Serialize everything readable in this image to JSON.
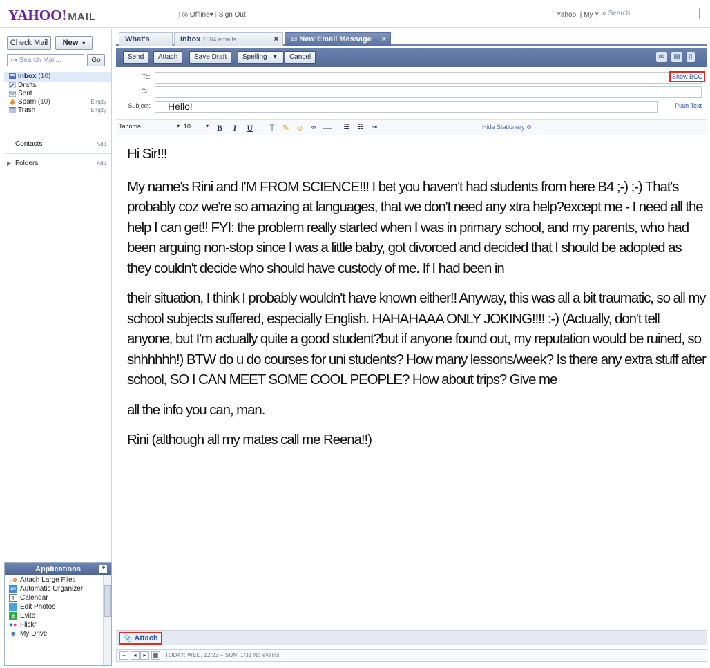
{
  "topbar": {
    "logo_main": "YAHOO!",
    "logo_mail": "MAIL",
    "status_offline": "Offline",
    "status_signout": "Sign Out",
    "link_yahoo": "Yahoo!",
    "link_myyahoo": "My Yahoo!",
    "search_placeholder": "Search"
  },
  "sidebar": {
    "check_mail": "Check Mail",
    "new_label": "New",
    "search_placeholder": "Search Mail...",
    "go_label": "Go",
    "folders": [
      {
        "label": "Inbox",
        "count": "(10)",
        "action": ""
      },
      {
        "label": "Drafts",
        "count": "",
        "action": ""
      },
      {
        "label": "Sent",
        "count": "",
        "action": ""
      },
      {
        "label": "Spam",
        "count": "(10)",
        "action": "Empty"
      },
      {
        "label": "Trash",
        "count": "",
        "action": "Empty"
      }
    ],
    "contacts_label": "Contacts",
    "contacts_action": "Add",
    "folders_label": "Folders",
    "folders_action": "Add",
    "applications": {
      "title": "Applications",
      "items": [
        "Attach Large Files",
        "Automatic Organizer",
        "Calendar",
        "Edit Photos",
        "Evite",
        "Flickr",
        "My Drive"
      ]
    }
  },
  "tabs": [
    {
      "label": "What's New",
      "sub": ""
    },
    {
      "label": "Inbox",
      "sub": "1064 emails"
    },
    {
      "label": "New Email Message",
      "sub": ""
    }
  ],
  "toolbar": {
    "send": "Send",
    "attach": "Attach",
    "save_draft": "Save Draft",
    "spelling": "Spelling",
    "cancel": "Cancel"
  },
  "headers": {
    "to_label": "To:",
    "to_value": "",
    "show_bcc": "Show BCC",
    "cc_label": "Cc:",
    "cc_value": "",
    "subject_label": "Subject:",
    "subject_value": "Hello!",
    "plain_text": "Plain Text"
  },
  "format": {
    "font": "Tahoma",
    "size": "10",
    "hide_stationery": "Hide Stationery"
  },
  "body": {
    "greeting": "Hi Sir!!!",
    "para1": "My name's Rini and I'M FROM SCIENCE!!! I bet you haven't had students from here B4 ;-) ;-) That's probably coz we're so amazing at languages, that we don't need any xtra help?except me - I need all the help I can get!! FYI: the problem really started when I was in primary school, and my parents, who had been arguing non-stop since I was a little baby, got divorced and decided that I should be adopted as they couldn't decide who should have custody of me. If I had been in",
    "para2": "their situation, I think I probably wouldn't have known either!! Anyway, this was all a bit traumatic, so all my school subjects suffered, especially English. HAHAHAAA ONLY JOKING!!!! :-) (Actually, don't tell anyone, but I'm actually quite a good student?but if anyone found out, my reputation would be ruined, so shhhhhh!) BTW do u do courses for uni students? How many lessons/week? Is there any extra stuff after school, SO I CAN MEET SOME COOL PEOPLE? How about trips? Give me",
    "para3": "all the info you can, man.",
    "signoff": "Rini (although all my mates call me Reena!!)"
  },
  "bottom": {
    "attach": "Attach",
    "calendar_text": "TODAY: WED, 12/23 – SUN, 1/31  No events"
  },
  "colors": {
    "accent": "#5a70a0",
    "highlight_box": "#e02a2a",
    "link": "#2c56a6",
    "logo": "#6b1f9c"
  }
}
